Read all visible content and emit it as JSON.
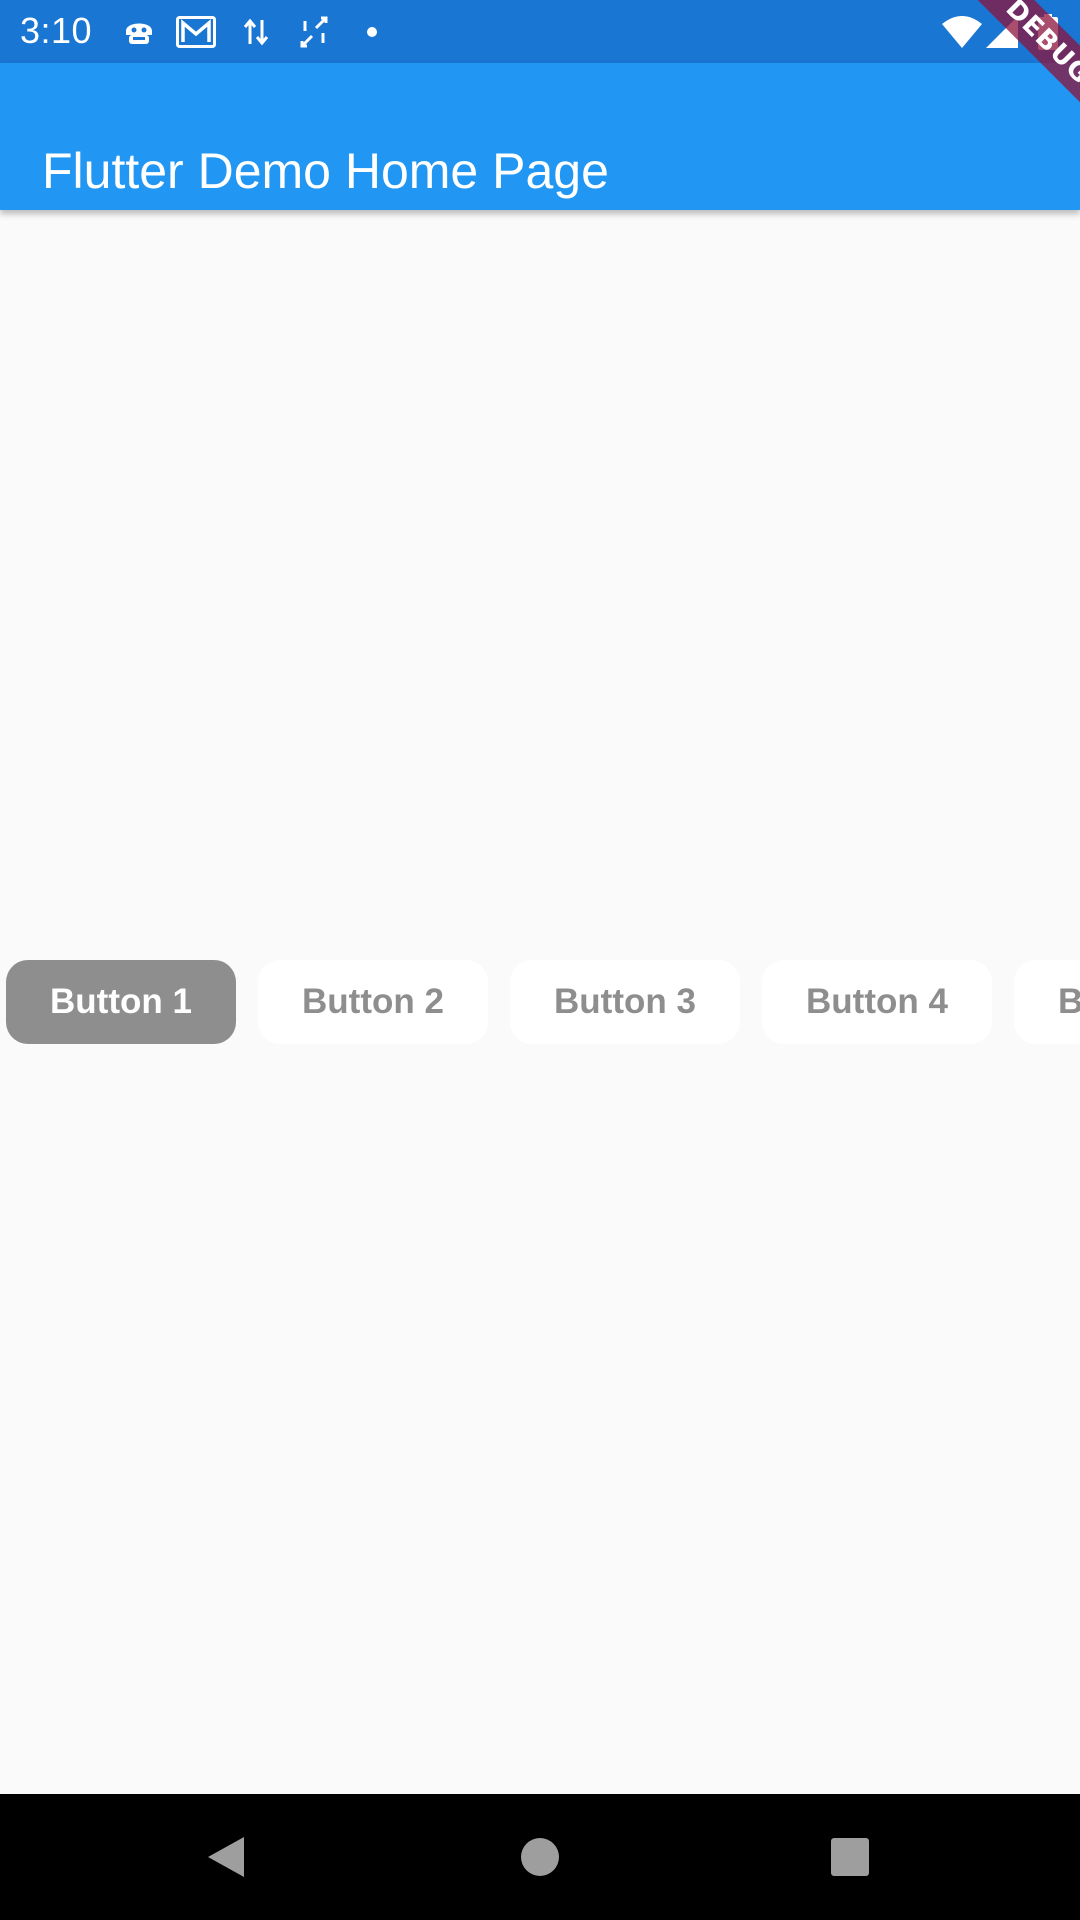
{
  "status_bar": {
    "time": "3:10",
    "left_icons": [
      "android-debug-icon",
      "gmail-icon",
      "data-transfer-icon",
      "screen-rotate-icon",
      "notification-dot-icon"
    ],
    "right_icons": [
      "wifi-icon",
      "cellular-signal-icon",
      "battery-icon"
    ],
    "background": "#1976d2"
  },
  "app_bar": {
    "title": "Flutter Demo Home Page",
    "background": "#2196f3"
  },
  "debug_banner": {
    "label": "DEBUG"
  },
  "segmented_buttons": {
    "selected_index": 0,
    "buttons": [
      {
        "label": "Button 1",
        "selected": true
      },
      {
        "label": "Button 2",
        "selected": false
      },
      {
        "label": "Button 3",
        "selected": false
      },
      {
        "label": "Button 4",
        "selected": false
      },
      {
        "label": "B",
        "selected": false
      }
    ],
    "selected_color": "#8e8e8e",
    "unselected_color": "#ffffff"
  },
  "navigation_bar": {
    "buttons": [
      "back-icon",
      "home-icon",
      "recents-icon"
    ]
  }
}
